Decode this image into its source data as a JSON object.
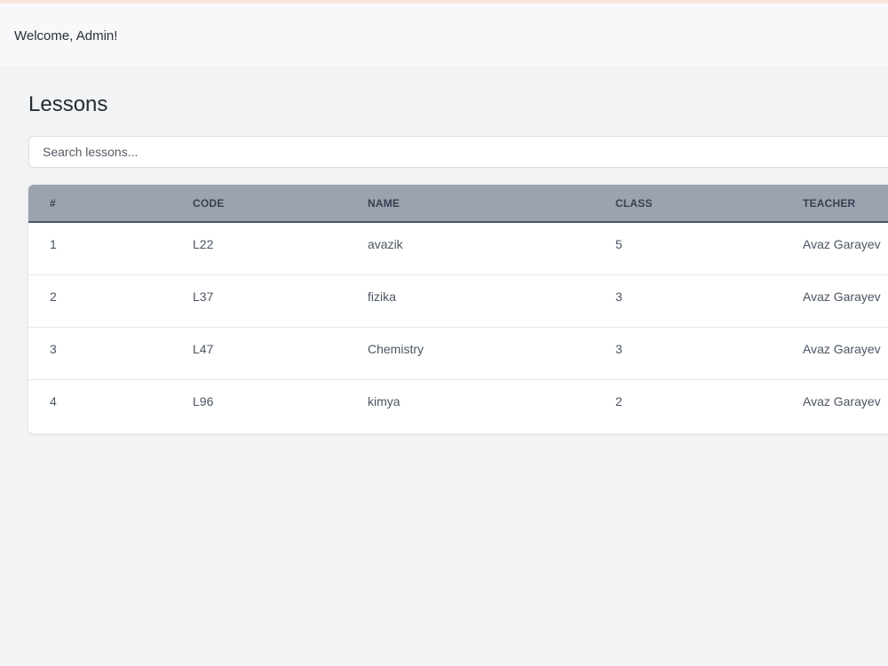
{
  "header": {
    "welcome_text": "Welcome, Admin!"
  },
  "page": {
    "title": "Lessons"
  },
  "search": {
    "placeholder": "Search lessons...",
    "value": ""
  },
  "table": {
    "columns": [
      "#",
      "CODE",
      "NAME",
      "CLASS",
      "TEACHER"
    ],
    "rows": [
      {
        "num": "1",
        "code": "L22",
        "name": "avazik",
        "class": "5",
        "teacher": "Avaz Garayev"
      },
      {
        "num": "2",
        "code": "L37",
        "name": "fizika",
        "class": "3",
        "teacher": "Avaz Garayev"
      },
      {
        "num": "3",
        "code": "L47",
        "name": "Chemistry",
        "class": "3",
        "teacher": "Avaz Garayev"
      },
      {
        "num": "4",
        "code": "L96",
        "name": "kimya",
        "class": "2",
        "teacher": "Avaz Garayev"
      }
    ]
  },
  "colors": {
    "header_bg": "#f7f8fa",
    "page_bg": "#f2f3f5",
    "table_header_bg": "#9ca3af",
    "top_accent": "#fbe3dc"
  }
}
